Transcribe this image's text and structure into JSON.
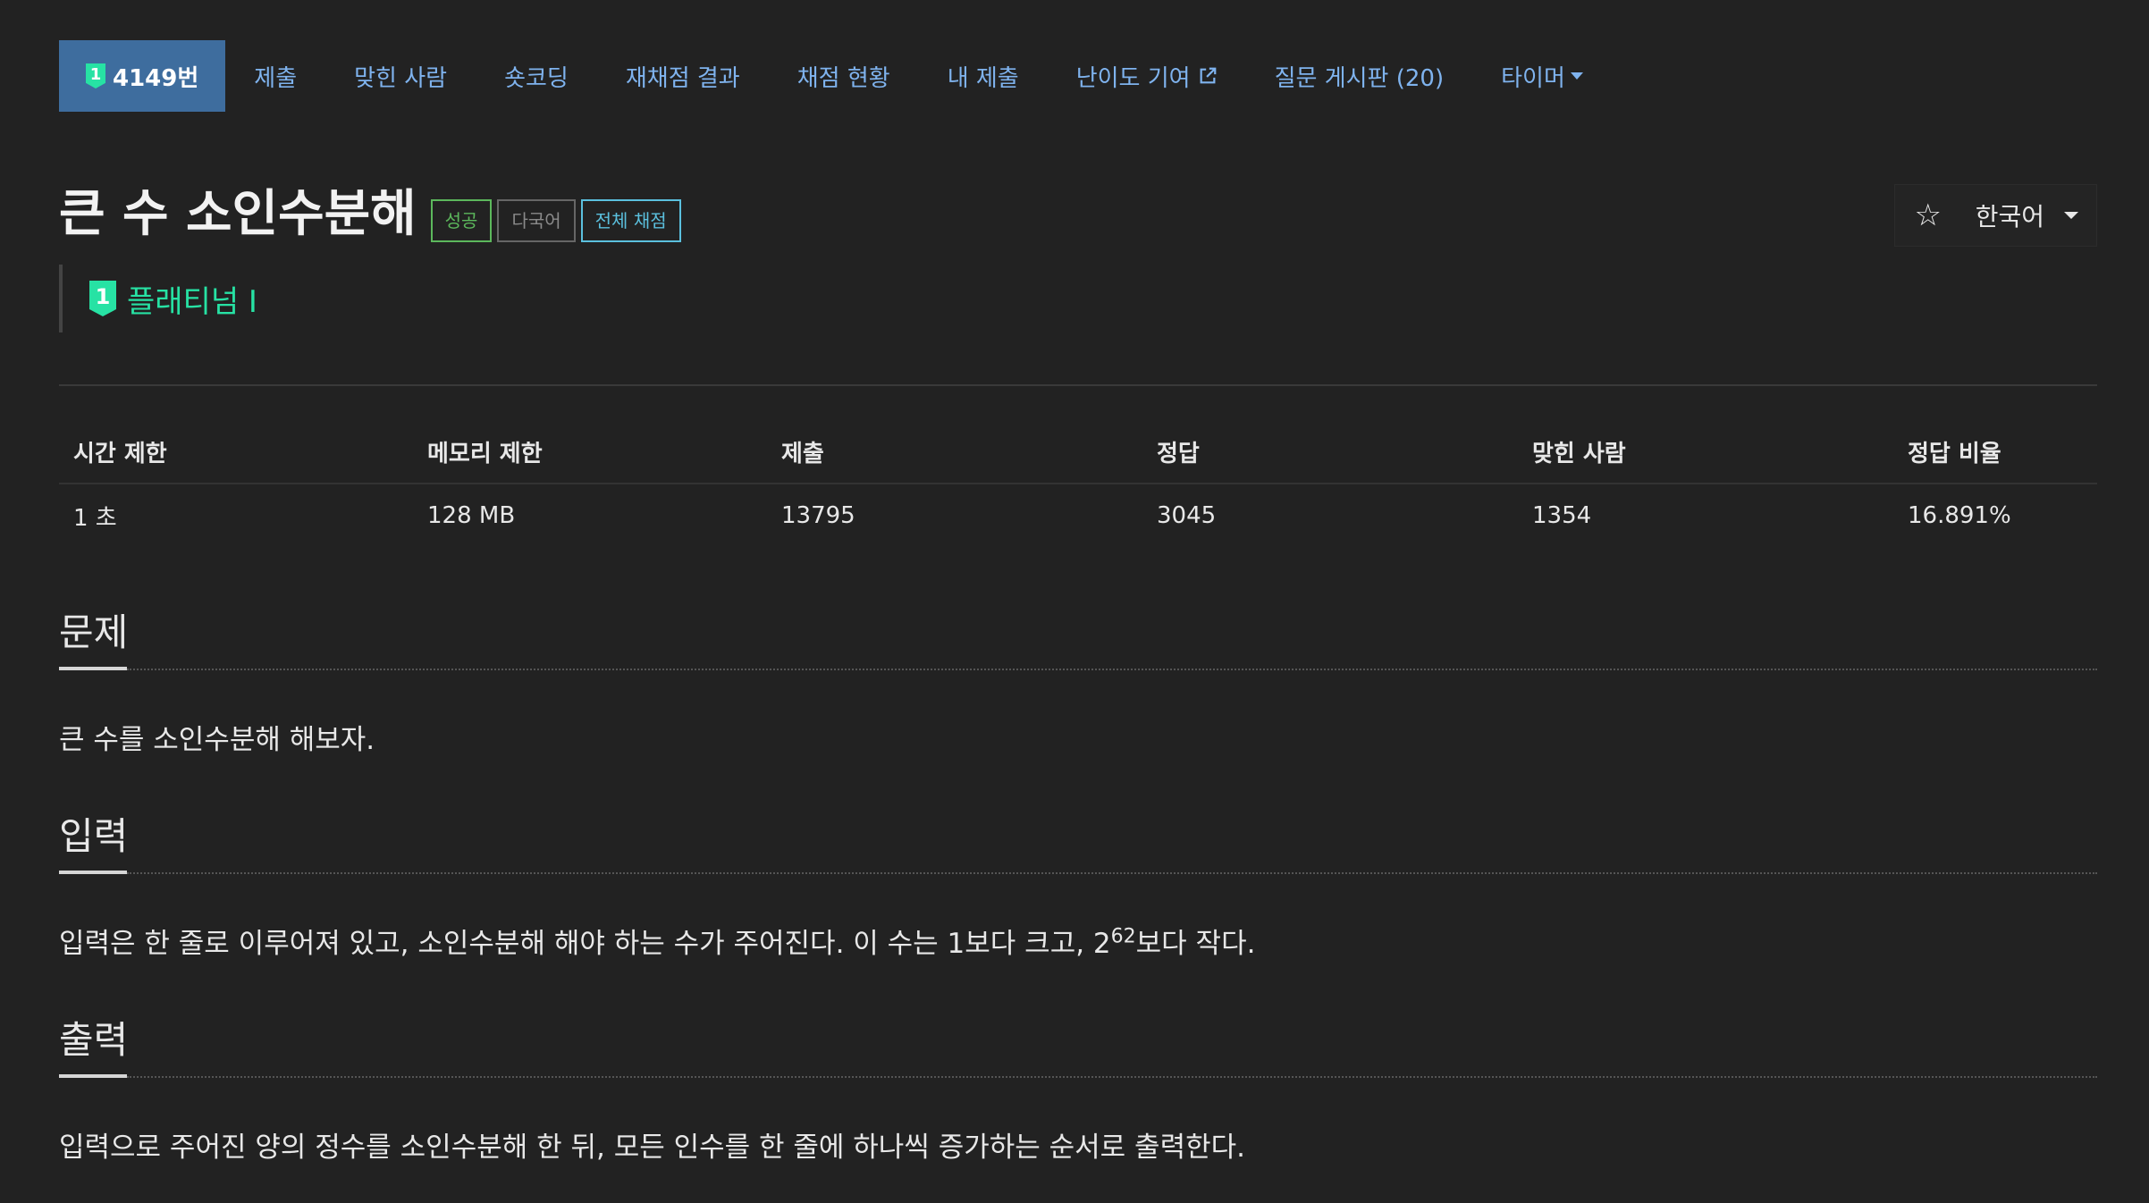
{
  "nav": {
    "problem_tier_digit": "1",
    "problem_number": "4149번",
    "items": [
      {
        "label": "제출"
      },
      {
        "label": "맞힌 사람"
      },
      {
        "label": "숏코딩"
      },
      {
        "label": "재채점 결과"
      },
      {
        "label": "채점 현황"
      },
      {
        "label": "내 제출"
      },
      {
        "label": "난이도 기여"
      },
      {
        "label": "질문 게시판 (20)"
      },
      {
        "label": "타이머"
      }
    ]
  },
  "problem": {
    "title": "큰 수 소인수분해",
    "labels": {
      "success": "성공",
      "multilang": "다국어",
      "full_judge": "전체 채점"
    },
    "tier": {
      "digit": "1",
      "name": "플래티넘 I"
    }
  },
  "controls": {
    "language": "한국어"
  },
  "info": {
    "headers": [
      "시간 제한",
      "메모리 제한",
      "제출",
      "정답",
      "맞힌 사람",
      "정답 비율"
    ],
    "values": [
      "1 초",
      "128 MB",
      "13795",
      "3045",
      "1354",
      "16.891%"
    ]
  },
  "sections": {
    "problem": {
      "title": "문제",
      "body": "큰 수를 소인수분해 해보자."
    },
    "input": {
      "title": "입력",
      "body_pre": "입력은 한 줄로 이루어져 있고, 소인수분해 해야 하는 수가 주어진다. 이 수는 1보다 크고, 2",
      "body_sup": "62",
      "body_post": "보다 작다."
    },
    "output": {
      "title": "출력",
      "body": "입력으로 주어진 양의 정수를 소인수분해 한 뒤, 모든 인수를 한 줄에 하나씩 증가하는 순서로 출력한다."
    }
  },
  "colors": {
    "background": "#222222",
    "nav_link": "#7fb3ee",
    "nav_active_bg": "#3e6d9e",
    "platinum": "#27e2a4",
    "success": "#5cb85c",
    "info": "#5bc0de"
  }
}
